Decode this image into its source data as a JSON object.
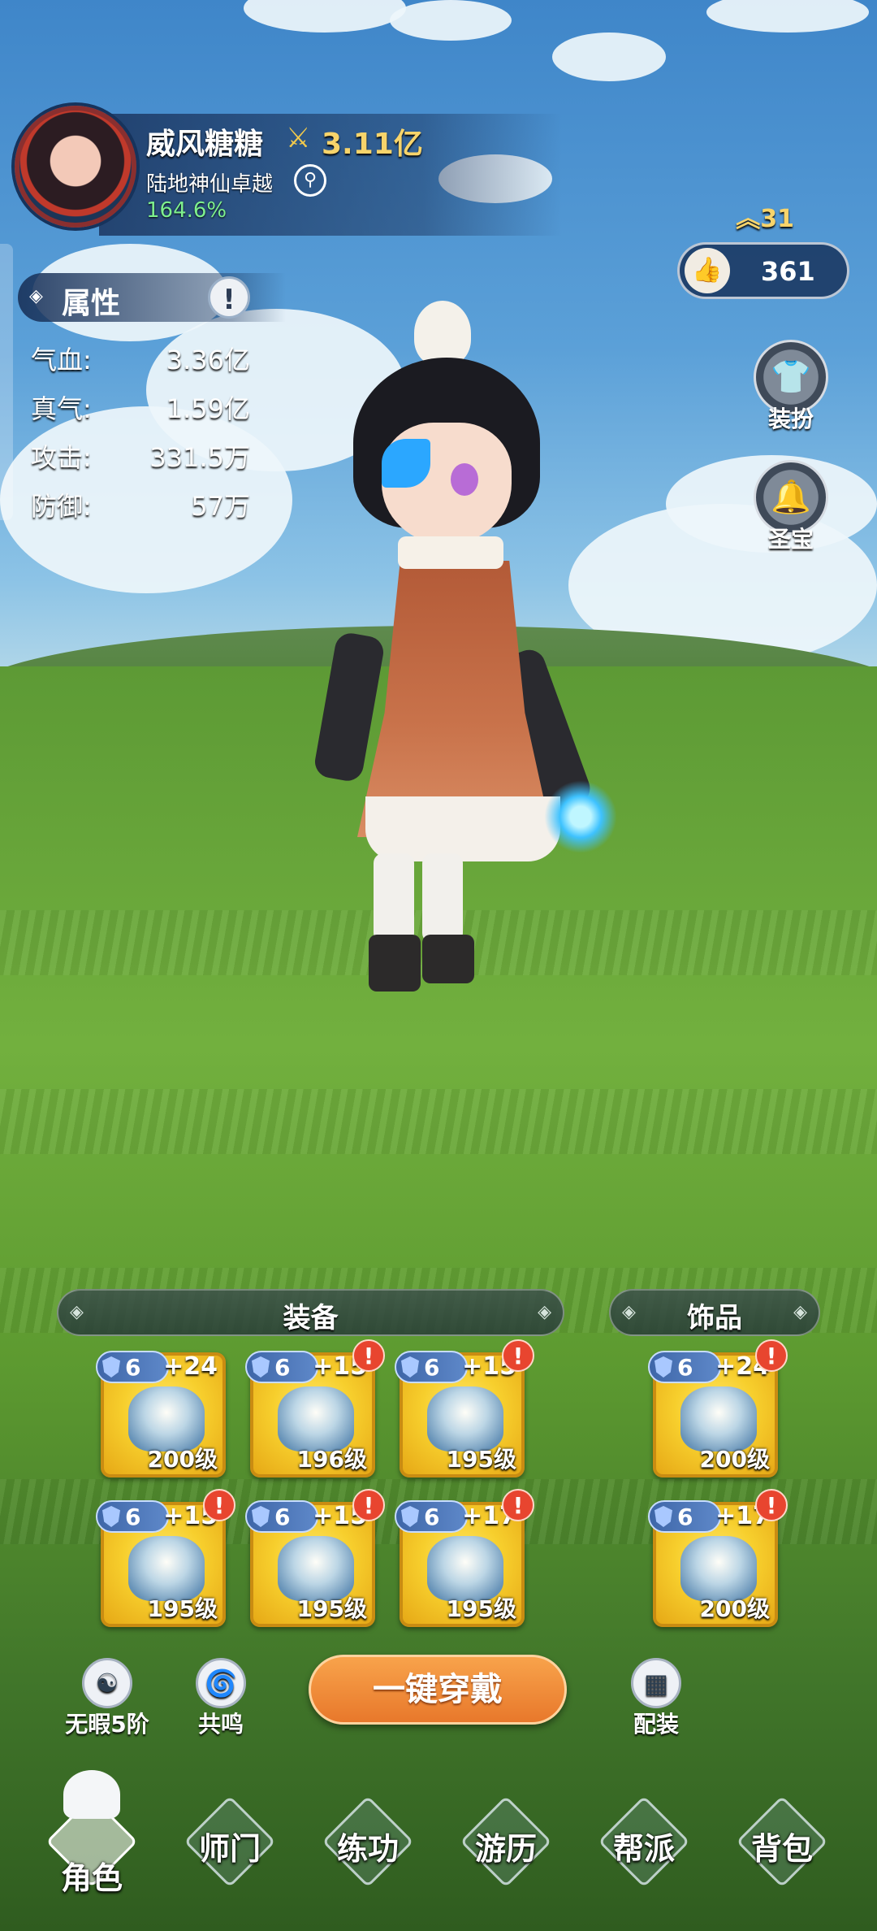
{
  "player": {
    "name": "威风糖糖",
    "power": "3.11亿",
    "realm": "陆地神仙卓越",
    "progress": "164.6%",
    "rank": "31",
    "likes": "361"
  },
  "attributes": {
    "title": "属性",
    "info_icon": "!",
    "rows": [
      {
        "label": "气血:",
        "value": "3.36亿"
      },
      {
        "label": "真气:",
        "value": "1.59亿"
      },
      {
        "label": "攻击:",
        "value": "331.5万"
      },
      {
        "label": "防御:",
        "value": "57万"
      }
    ]
  },
  "side_buttons": {
    "outfit": "装扮",
    "treasure": "圣宝"
  },
  "equipment": {
    "title": "装备",
    "slots": [
      {
        "tier": "6",
        "plus": "+24",
        "level": "200级",
        "alert": false,
        "icon": "sword-icon"
      },
      {
        "tier": "6",
        "plus": "+15",
        "level": "196级",
        "alert": true,
        "icon": "hat-icon"
      },
      {
        "tier": "6",
        "plus": "+15",
        "level": "195级",
        "alert": true,
        "icon": "armor-icon"
      },
      {
        "tier": "6",
        "plus": "+15",
        "level": "195级",
        "alert": true,
        "icon": "robe-icon"
      },
      {
        "tier": "6",
        "plus": "+15",
        "level": "195级",
        "alert": true,
        "icon": "bracer-icon"
      },
      {
        "tier": "6",
        "plus": "+17",
        "level": "195级",
        "alert": true,
        "icon": "boots-icon"
      }
    ]
  },
  "accessories": {
    "title": "饰品",
    "slots": [
      {
        "tier": "6",
        "plus": "+24",
        "level": "200级",
        "alert": true,
        "icon": "ring-icon"
      },
      {
        "tier": "6",
        "plus": "+17",
        "level": "200级",
        "alert": true,
        "icon": "pendant-icon"
      }
    ]
  },
  "actions": {
    "flawless": "无暇5阶",
    "resonance": "共鸣",
    "equip_all": "一键穿戴",
    "loadout": "配装"
  },
  "nav": [
    {
      "label": "角色",
      "active": true
    },
    {
      "label": "师门",
      "active": false
    },
    {
      "label": "练功",
      "active": false
    },
    {
      "label": "游历",
      "active": false
    },
    {
      "label": "帮派",
      "active": false
    },
    {
      "label": "背包",
      "active": false
    }
  ],
  "colors": {
    "power_gold": "#f7d46b",
    "progress_green": "#7ef08e",
    "equip_button": "#e8782b",
    "alert_red": "#e8452f"
  }
}
